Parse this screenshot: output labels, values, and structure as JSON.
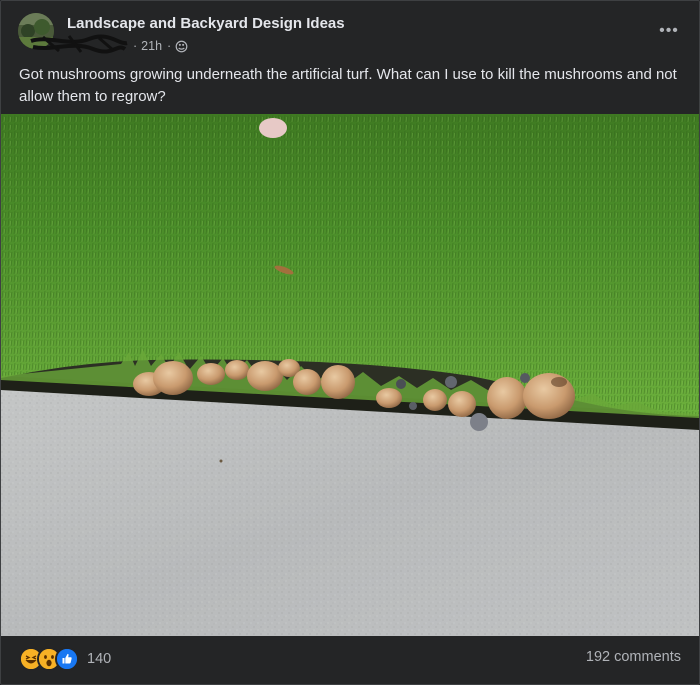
{
  "post": {
    "group_name": "Landscape and Backyard Design Ideas",
    "time": "21h",
    "separator": "·",
    "privacy_icon": "globe-icon",
    "more_icon": "more-options-icon",
    "more_label": "•••",
    "text": "Got mushrooms growing underneath the artificial turf. What can I use to kill the mushrooms and not allow them to regrow?"
  },
  "reactions": {
    "icons": [
      "haha-icon",
      "wow-icon",
      "like-icon"
    ],
    "count": "140"
  },
  "comments": {
    "label": "192 comments"
  },
  "colors": {
    "background": "#242526",
    "text_primary": "#e4e6eb",
    "text_secondary": "#b0b3b8",
    "like_blue": "#1877f2",
    "haha_yellow": "#f7b125"
  }
}
